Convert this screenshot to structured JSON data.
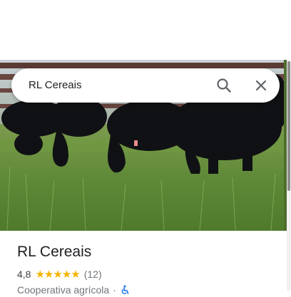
{
  "search": {
    "query": "RL Cereais",
    "search_icon": "search-icon",
    "close_icon": "close-icon"
  },
  "photo": {
    "subject": "cattle-grazing-photo"
  },
  "place": {
    "title": "RL Cereais",
    "rating": "4,8",
    "stars": "★★★★★",
    "review_count": "(12)",
    "category": "Cooperativa agrícola",
    "separator": "·",
    "accessibility_icon": "wheelchair-icon"
  },
  "colors": {
    "star": "#f4b400",
    "accessibility": "#1a73e8",
    "text_primary": "#202124",
    "text_secondary": "#70757a"
  }
}
